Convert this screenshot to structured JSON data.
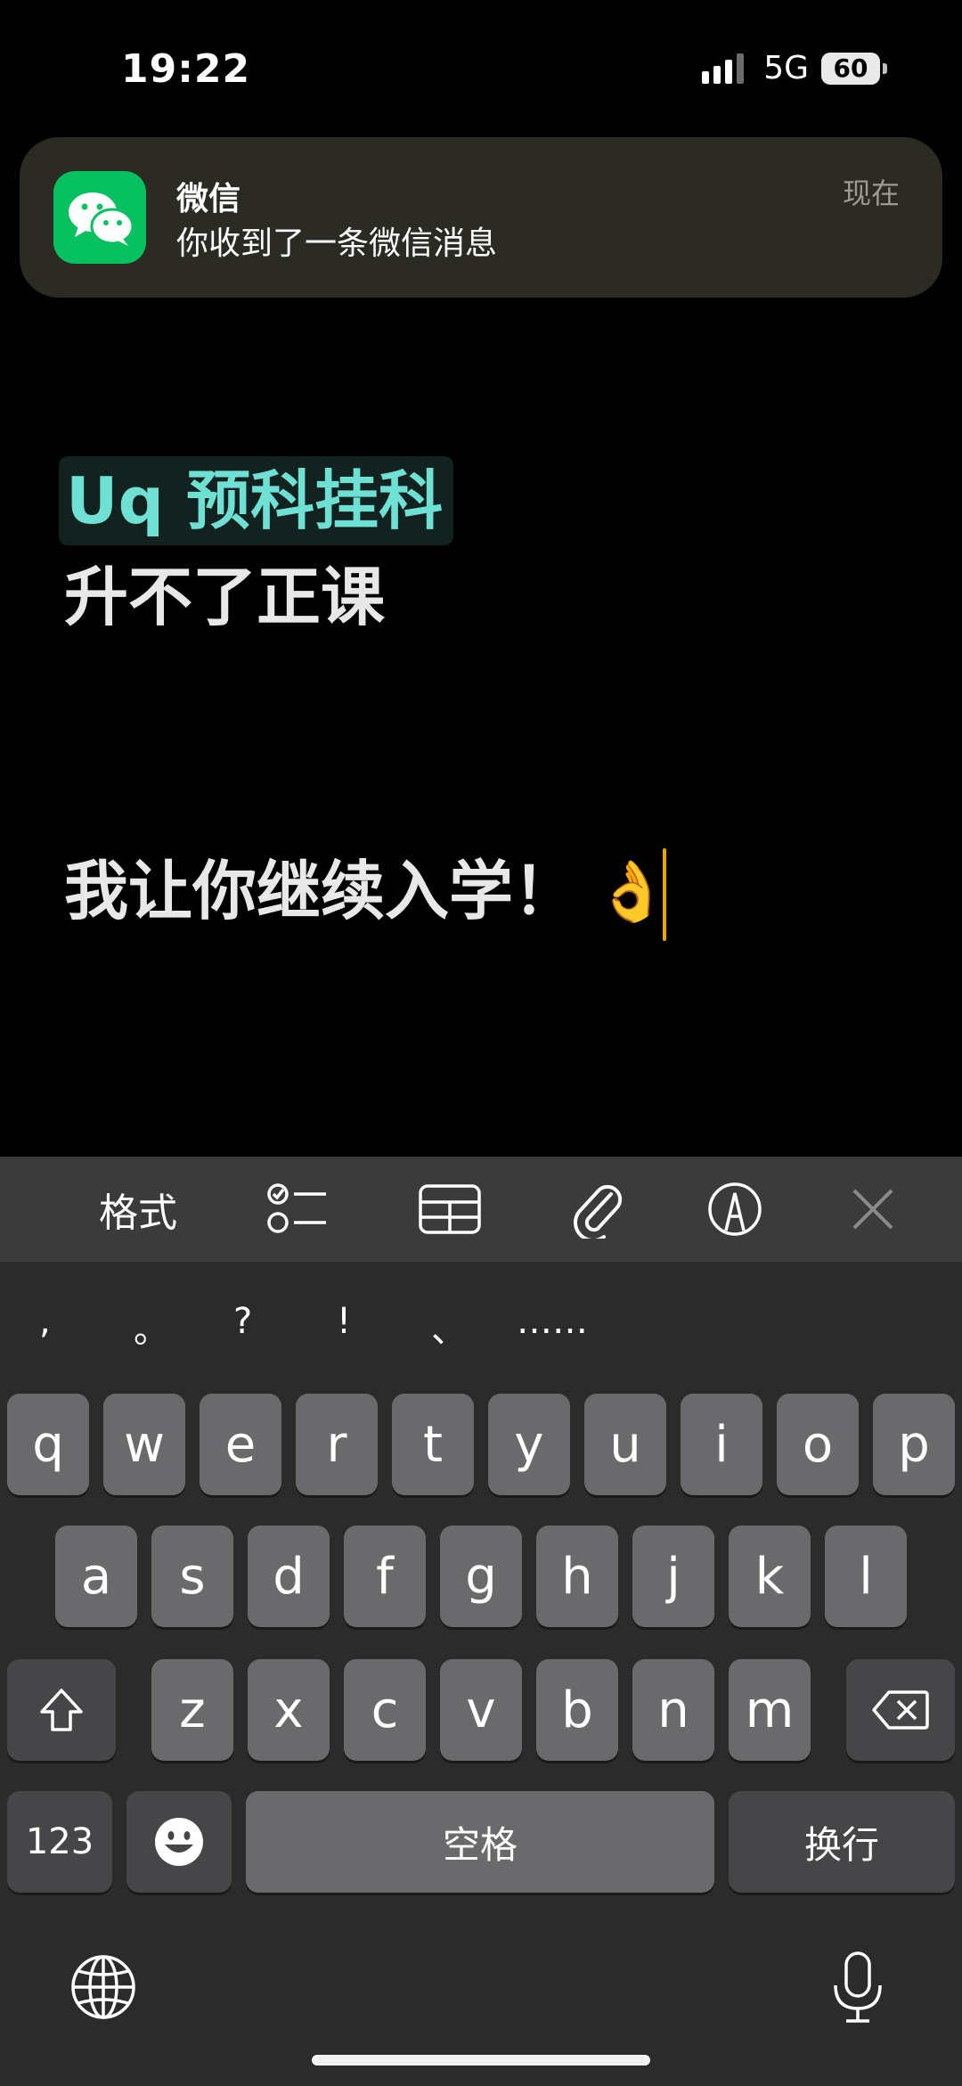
{
  "status_bar": {
    "time": "19:22",
    "network": "5G",
    "battery": "60"
  },
  "notification": {
    "app": "微信",
    "message": "你收到了一条微信消息",
    "time": "现在"
  },
  "note": {
    "line1": "Uq 预科挂科",
    "line2": "升不了正课",
    "line3": "我让你继续入学！",
    "emoji": "👌"
  },
  "toolbar": {
    "format": "格式"
  },
  "keyboard": {
    "punctuation": [
      ",",
      "。",
      "?",
      "!",
      "、",
      "……"
    ],
    "row1": [
      "q",
      "w",
      "e",
      "r",
      "t",
      "y",
      "u",
      "i",
      "o",
      "p"
    ],
    "row2": [
      "a",
      "s",
      "d",
      "f",
      "g",
      "h",
      "j",
      "k",
      "l"
    ],
    "row3": [
      "z",
      "x",
      "c",
      "v",
      "b",
      "n",
      "m"
    ],
    "numbers_label": "123",
    "space_label": "空格",
    "return_label": "换行"
  }
}
